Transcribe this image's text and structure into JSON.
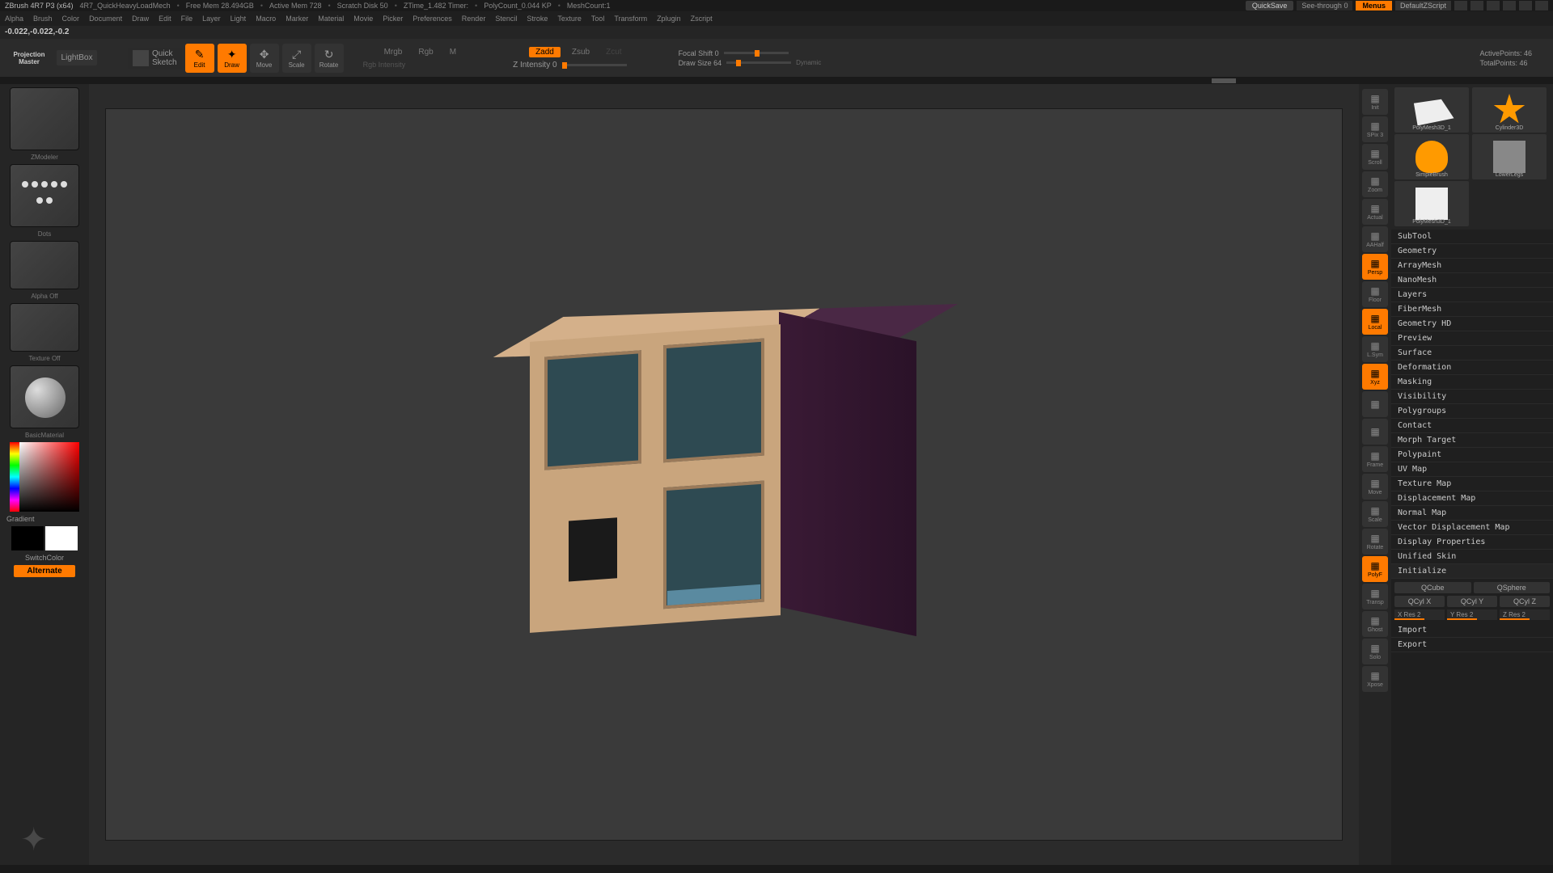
{
  "status": {
    "app": "ZBrush 4R7 P3 (x64)",
    "file": "4R7_QuickHeavyLoadMech",
    "freeMem": "Free Mem 28.494GB",
    "activeMem": "Active Mem 728",
    "scratch": "Scratch Disk 50",
    "ztime": "ZTime_1.482 Timer:",
    "polycount": "PolyCount_0.044 KP",
    "meshcount": "MeshCount:1",
    "quicksave": "QuickSave",
    "seethrough": "See-through  0",
    "menus": "Menus",
    "script": "DefaultZScript"
  },
  "menus": [
    "Alpha",
    "Brush",
    "Color",
    "Document",
    "Draw",
    "Edit",
    "File",
    "Layer",
    "Light",
    "Macro",
    "Marker",
    "Material",
    "Movie",
    "Picker",
    "Preferences",
    "Render",
    "Stencil",
    "Stroke",
    "Texture",
    "Tool",
    "Transform",
    "Zplugin",
    "Zscript"
  ],
  "coords": "-0.022,-0.022,-0.2",
  "toolbar": {
    "projection": "Projection\nMaster",
    "lightbox": "LightBox",
    "quicksketch": "Quick\nSketch",
    "edit": "Edit",
    "draw": "Draw",
    "move": "Move",
    "scale": "Scale",
    "rotate": "Rotate",
    "modes_top": [
      "Mrgb",
      "Rgb",
      "M"
    ],
    "modes_bot_label": "Rgb Intensity",
    "zadd": "Zadd",
    "zsub": "Zsub",
    "zcut": "Zcut",
    "zintensity": "Z Intensity 0",
    "focal": "Focal Shift 0",
    "drawsize": "Draw Size 64",
    "dynamic": "Dynamic",
    "active": "ActivePoints: 46",
    "total": "TotalPoints: 46"
  },
  "left": {
    "zmodeler": "ZModeler",
    "dots": "Dots",
    "alpha": "Alpha Off",
    "texture": "Texture Off",
    "material": "BasicMaterial",
    "gradient": "Gradient",
    "switchcolor": "SwitchColor",
    "alternate": "Alternate"
  },
  "sideIcons": [
    {
      "label": "Init",
      "active": false
    },
    {
      "label": "SPix 3",
      "active": false
    },
    {
      "label": "Scroll",
      "active": false
    },
    {
      "label": "Zoom",
      "active": false
    },
    {
      "label": "Actual",
      "active": false
    },
    {
      "label": "AAHalf",
      "active": false
    },
    {
      "label": "Persp",
      "active": true
    },
    {
      "label": "Floor",
      "active": false
    },
    {
      "label": "Local",
      "active": true
    },
    {
      "label": "L.Sym",
      "active": false
    },
    {
      "label": "Xyz",
      "active": true
    },
    {
      "label": "",
      "active": false
    },
    {
      "label": "",
      "active": false
    },
    {
      "label": "Frame",
      "active": false
    },
    {
      "label": "Move",
      "active": false
    },
    {
      "label": "Scale",
      "active": false
    },
    {
      "label": "Rotate",
      "active": false
    },
    {
      "label": "PolyF",
      "active": true
    },
    {
      "label": "Transp",
      "active": false
    },
    {
      "label": "Ghost",
      "active": false
    },
    {
      "label": "Solo",
      "active": false
    },
    {
      "label": "Xpose",
      "active": false
    }
  ],
  "thumbs": [
    {
      "label": "PolyMesh3D_1",
      "shape": "plane"
    },
    {
      "label": "Cylinder3D",
      "shape": "star"
    },
    {
      "label": "SimpleBrush",
      "shape": "simple"
    },
    {
      "label": "LowerLegs",
      "shape": "legs"
    },
    {
      "label": "PolyMesh3D_1",
      "shape": "cube"
    }
  ],
  "accordion": [
    "SubTool",
    "Geometry",
    "ArrayMesh",
    "NanoMesh",
    "Layers",
    "FiberMesh",
    "Geometry HD",
    "Preview",
    "Surface",
    "Deformation",
    "Masking",
    "Visibility",
    "Polygroups",
    "Contact",
    "Morph Target",
    "Polypaint",
    "UV Map",
    "Texture Map",
    "Displacement Map",
    "Normal Map",
    "Vector Displacement Map",
    "Display Properties",
    "Unified Skin",
    "Initialize"
  ],
  "initialize": {
    "qcube": "QCube",
    "qsphere": "QSphere",
    "qcylx": "QCyl X",
    "qcyly": "QCyl Y",
    "qcylz": "QCyl Z",
    "xres": "X Res 2",
    "yres": "Y Res 2",
    "zres": "Z Res 2"
  },
  "importExport": {
    "import": "Import",
    "export": "Export"
  }
}
